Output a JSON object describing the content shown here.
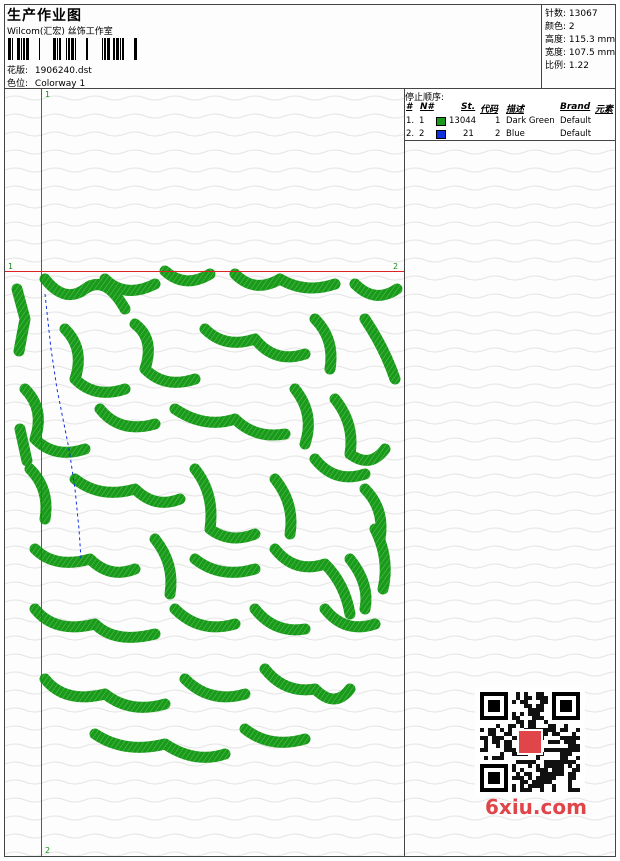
{
  "header": {
    "title": "生产作业图",
    "studio": "Wilcom(汇宏) 丝饰工作室",
    "design_label": "花版:",
    "design_value": "1906240.dst",
    "colorway_label": "色位:",
    "colorway_value": "Colorway 1"
  },
  "stats": [
    {
      "label": "针数:",
      "value": "13067"
    },
    {
      "label": "颜色:",
      "value": "2"
    },
    {
      "label": "高度:",
      "value": "115.3 mm"
    },
    {
      "label": "宽度:",
      "value": "107.5 mm"
    },
    {
      "label": "比例:",
      "value": "1.22"
    }
  ],
  "stop_sequence": {
    "title": "停止顺序:",
    "columns": [
      "#",
      "N#",
      "St.",
      "代码",
      "描述",
      "Brand",
      "元素"
    ],
    "rows": [
      {
        "num": "1.",
        "n": "1",
        "color": "#1a9a1a",
        "stitches": "13044",
        "code": "1",
        "desc": "Dark Green",
        "brand": "Default"
      },
      {
        "num": "2.",
        "n": "2",
        "color": "#1030e0",
        "stitches": "21",
        "code": "2",
        "desc": "Blue",
        "brand": "Default"
      }
    ]
  },
  "guides": {
    "v_top": "1",
    "v_bottom": "2",
    "h_left": "1",
    "h_right": "2"
  },
  "watermark": {
    "text": "6xiu.com"
  },
  "colors": {
    "stitch": "#1a9a1a",
    "guide": "#dd2222",
    "accent": "#e0454a"
  }
}
